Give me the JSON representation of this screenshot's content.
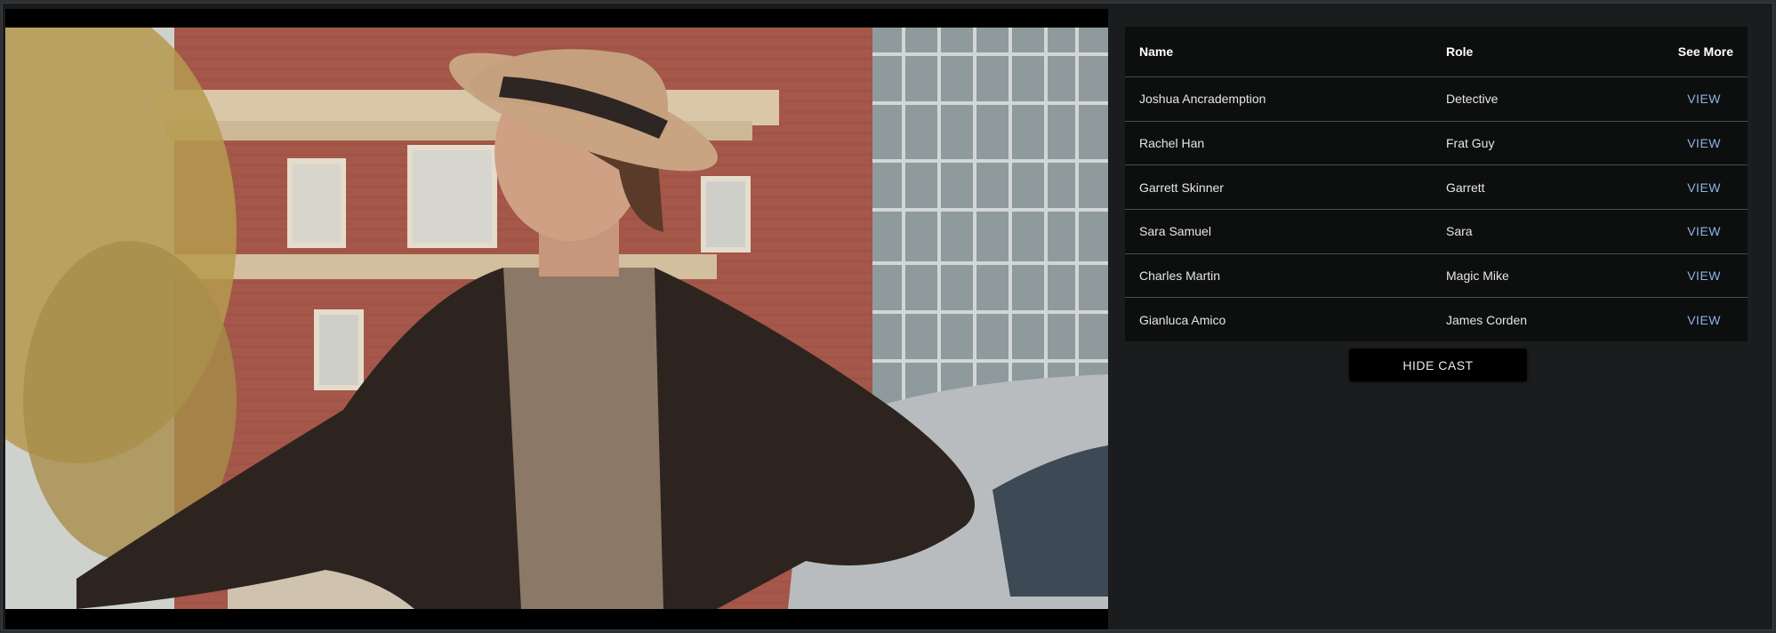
{
  "cast_table": {
    "headers": {
      "name": "Name",
      "role": "Role",
      "see_more": "See More"
    },
    "rows": [
      {
        "name": "Joshua Ancrademption",
        "role": "Detective",
        "action": "VIEW"
      },
      {
        "name": "Rachel Han",
        "role": "Frat Guy",
        "action": "VIEW"
      },
      {
        "name": "Garrett Skinner",
        "role": "Garrett",
        "action": "VIEW"
      },
      {
        "name": "Sara Samuel",
        "role": "Sara",
        "action": "VIEW"
      },
      {
        "name": "Charles Martin",
        "role": "Magic Mike",
        "action": "VIEW"
      },
      {
        "name": "Gianluca Amico",
        "role": "James Corden",
        "action": "VIEW"
      }
    ]
  },
  "hide_cast_button": "HIDE CAST"
}
